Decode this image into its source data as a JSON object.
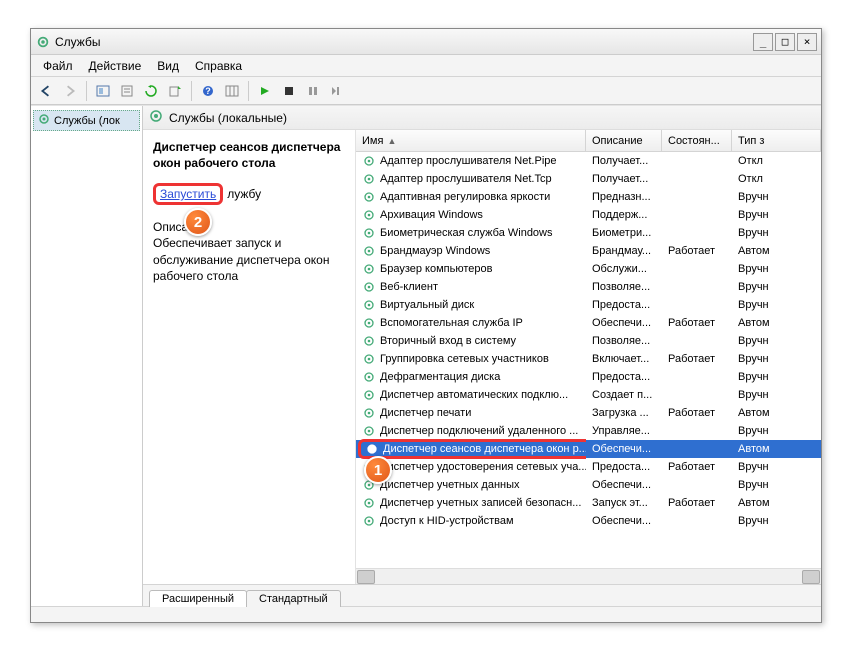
{
  "window_title": "Службы",
  "menu": {
    "file": "Файл",
    "action": "Действие",
    "view": "Вид",
    "help": "Справка"
  },
  "tree": {
    "item": "Службы (лок"
  },
  "content_title": "Службы (локальные)",
  "detail": {
    "selected_name": "Диспетчер сеансов диспетчера окон рабочего стола",
    "start_label": "Запустить",
    "start_suffix": "лужбу",
    "desc_label": "Описан",
    "desc_text": "Обеспечивает запуск и обслуживание диспетчера окон рабочего стола"
  },
  "columns": {
    "name": "Имя",
    "desc": "Описание",
    "state": "Состоян...",
    "type": "Тип з"
  },
  "rows": [
    {
      "name": "Адаптер прослушивателя Net.Pipe",
      "desc": "Получает...",
      "state": "",
      "type": "Откл"
    },
    {
      "name": "Адаптер прослушивателя Net.Tcp",
      "desc": "Получает...",
      "state": "",
      "type": "Откл"
    },
    {
      "name": "Адаптивная регулировка яркости",
      "desc": "Предназн...",
      "state": "",
      "type": "Вручн"
    },
    {
      "name": "Архивация Windows",
      "desc": "Поддерж...",
      "state": "",
      "type": "Вручн"
    },
    {
      "name": "Биометрическая служба Windows",
      "desc": "Биометри...",
      "state": "",
      "type": "Вручн"
    },
    {
      "name": "Брандмауэр Windows",
      "desc": "Брандмау...",
      "state": "Работает",
      "type": "Автом"
    },
    {
      "name": "Браузер компьютеров",
      "desc": "Обслужи...",
      "state": "",
      "type": "Вручн"
    },
    {
      "name": "Веб-клиент",
      "desc": "Позволяе...",
      "state": "",
      "type": "Вручн"
    },
    {
      "name": "Виртуальный диск",
      "desc": "Предоста...",
      "state": "",
      "type": "Вручн"
    },
    {
      "name": "Вспомогательная служба IP",
      "desc": "Обеспечи...",
      "state": "Работает",
      "type": "Автом"
    },
    {
      "name": "Вторичный вход в систему",
      "desc": "Позволяе...",
      "state": "",
      "type": "Вручн"
    },
    {
      "name": "Группировка сетевых участников",
      "desc": "Включает...",
      "state": "Работает",
      "type": "Вручн"
    },
    {
      "name": "Дефрагментация диска",
      "desc": "Предоста...",
      "state": "",
      "type": "Вручн"
    },
    {
      "name": "Диспетчер автоматических подклю...",
      "desc": "Создает п...",
      "state": "",
      "type": "Вручн"
    },
    {
      "name": "Диспетчер печати",
      "desc": "Загрузка ...",
      "state": "Работает",
      "type": "Автом"
    },
    {
      "name": "Диспетчер подключений удаленного ...",
      "desc": "Управляе...",
      "state": "",
      "type": "Вручн"
    },
    {
      "name": "Диспетчер сеансов диспетчера окон р...",
      "desc": "Обеспечи...",
      "state": "",
      "type": "Автом",
      "selected": true
    },
    {
      "name": "Диспетчер удостоверения сетевых уча...",
      "desc": "Предоста...",
      "state": "Работает",
      "type": "Вручн"
    },
    {
      "name": "Диспетчер учетных данных",
      "desc": "Обеспечи...",
      "state": "",
      "type": "Вручн"
    },
    {
      "name": "Диспетчер учетных записей безопасн...",
      "desc": "Запуск эт...",
      "state": "Работает",
      "type": "Автом"
    },
    {
      "name": "Доступ к HID-устройствам",
      "desc": "Обеспечи...",
      "state": "",
      "type": "Вручн"
    }
  ],
  "tabs": {
    "ext": "Расширенный",
    "std": "Стандартный"
  }
}
